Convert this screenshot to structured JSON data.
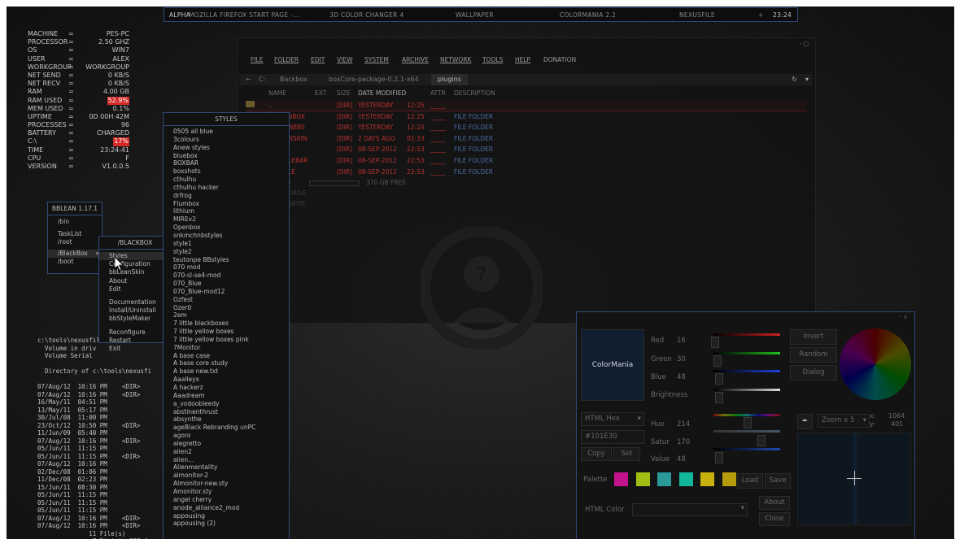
{
  "taskbar": {
    "items": [
      "ALPHA",
      "MOZILLA FIREFOX START PAGE -...",
      "3D COLOR CHANGER 4",
      "WALLPAPER",
      "COLORMANIA 2.2",
      "NEXUSFILE"
    ],
    "tray": "+",
    "clock": "23:24"
  },
  "stats": [
    {
      "k": "MACHINE",
      "v": "PES-PC"
    },
    {
      "k": "PROCESSOR",
      "v": "2.50 GHZ"
    },
    {
      "k": "OS",
      "v": "WIN7"
    },
    {
      "k": "USER",
      "v": "ALEX"
    },
    {
      "k": "WORKGROUP",
      "v": "WORKGROUP"
    },
    {
      "k": "NET SEND",
      "v": "0 KB/S"
    },
    {
      "k": "NET RECV",
      "v": "0 KB/S"
    },
    {
      "k": "RAM",
      "v": "4.00 GB"
    },
    {
      "k": "RAM USED",
      "v": "52.9%"
    },
    {
      "k": "MEM USED",
      "v": "0.1%"
    },
    {
      "k": "UPTIME",
      "v": "0D 00H 42M"
    },
    {
      "k": "PROCESSES",
      "v": "96"
    },
    {
      "k": "BATTERY",
      "v": "CHARGED"
    },
    {
      "k": "C:\\",
      "v": "17%"
    },
    {
      "k": "TIME",
      "v": "23:24:41"
    },
    {
      "k": "CPU",
      "v": "F"
    },
    {
      "k": "VERSION",
      "v": "V1.0.0.5"
    }
  ],
  "bblean": {
    "title": "BBLEAN 1.17.1",
    "items": [
      "/bin",
      "TaskList",
      "/root",
      "/BlackBox",
      "/boot"
    ]
  },
  "blackbox": {
    "title": "/BLACKBOX",
    "items": [
      "Styles",
      "Configuration",
      "bbLeanSkin",
      "About",
      "Edit",
      "Documentation",
      "Install/Uninstall",
      "bbStyleMaker",
      "Reconfigure",
      "Restart",
      "Exit"
    ]
  },
  "styles": {
    "title": "STYLES",
    "items": [
      "0505 all blue",
      "3colours",
      "Anew styles",
      "bluebox",
      "BOXBAR",
      "boxshots",
      "cthulhu",
      "cthulhu hacker",
      "drfrog",
      "Flumbox",
      "lithium",
      "MIREv2",
      "Openbox",
      "snkmchnbstyles",
      "style1",
      "style2",
      "teutonpe BBstyles",
      "070 mod",
      "070-sl-se4-mod",
      "070_Blue",
      "070_Blue-mod12",
      "Ozfest",
      "Ozer0",
      "2em",
      "7 little blackboxes",
      "7 little yellow boxes",
      "7 little yellow boxes pink",
      "7Monitor",
      "A base case",
      "A base core study",
      "A base new.txt",
      "Aaalleyx",
      "A hackerz",
      "Aaadream",
      "a_vodoobleedy",
      "abstinenthrust",
      "absynthe",
      "ageBlack Rebranding unPC",
      "agoro",
      "alegretto",
      "alien2",
      "alien...",
      "Alienmentality",
      "almonitor-2",
      "Almonitor-new.sty",
      "Amonitor.sty",
      "angel cherry",
      "anode_alliance2_mod",
      "appousing",
      "appousing (2)"
    ]
  },
  "explorer": {
    "menu": [
      "FILE",
      "FOLDER",
      "EDIT",
      "VIEW",
      "SYSTEM",
      "ARCHIVE",
      "NETWORK",
      "TOOLS",
      "HELP",
      "DONATION"
    ],
    "path": [
      "C:",
      "Backbox",
      "boxCore-package-0.2.1-x64",
      "plugins"
    ],
    "columns": [
      "NAME",
      "EXT",
      "SIZE",
      "DATE MODIFIED",
      "ATTR",
      "DESCRIPTION"
    ],
    "rows": [
      {
        "name": "..",
        "size": "[DIR]",
        "date": "YESTERDAY",
        "time": "12:25",
        "attr": "_____",
        "desc": ""
      },
      {
        "name": "BBICONBOX",
        "size": "[DIR]",
        "date": "YESTERDAY",
        "time": "12:25",
        "attr": "_____",
        "desc": "FILE FOLDER"
      },
      {
        "name": "BBLEANBBS",
        "size": "[DIR]",
        "date": "YESTERDAY",
        "time": "12:24",
        "attr": "_____",
        "desc": "FILE FOLDER"
      },
      {
        "name": "BBLEANSKIN",
        "size": "[DIR]",
        "date": "2 DAYS AGO",
        "time": "01:33",
        "attr": "_____",
        "desc": "FILE FOLDER"
      },
      {
        "name": "BBSLIT",
        "size": "[DIR]",
        "date": "08-SEP-2012",
        "time": "22:53",
        "attr": "_____",
        "desc": "FILE FOLDER"
      },
      {
        "name": "BBSTYLEBAR",
        "size": "[DIR]",
        "date": "08-SEP-2012",
        "time": "22:53",
        "attr": "_____",
        "desc": "FILE FOLDER"
      },
      {
        "name": "BBSTYLE",
        "size": "[DIR]",
        "date": "08-SEP-2012",
        "time": "22:53",
        "attr": "_____",
        "desc": "FILE FOLDER"
      }
    ],
    "drives": [
      {
        "label": "C: HDD",
        "free": "370 GB FREE"
      },
      {
        "label": "D: CD DRIVE",
        "free": ""
      },
      {
        "label": "E: CD DRIVE",
        "free": ""
      }
    ]
  },
  "console": {
    "lines": [
      "c:\\tools\\nexusfil",
      "  Volume in driv",
      "  Volume Serial",
      "",
      "  Directory of c:\\tools\\nexusfi",
      "",
      "07/Aug/12  10:16 PM    <DIR>",
      "07/Aug/12  10:16 PM    <DIR>",
      "16/May/11  04:51 PM",
      "13/May/11  05:17 PM",
      "30/Jul/08  11:00 PM",
      "23/Oct/12  10:50 PM    <DIR>",
      "11/Jun/09  05:40 PM",
      "07/Aug/12  10:16 PM    <DIR>",
      "05/Jun/11  11:15 PM",
      "05/Jun/11  11:15 PM    <DIR>",
      "07/Aug/12  10:16 PM",
      "02/Dec/08  01:06 PM",
      "11/Dec/08  02:23 PM",
      "15/Jun/11  08:30 PM",
      "05/Jun/11  11:15 PM",
      "05/Jun/11  11:15 PM",
      "05/Jun/11  11:15 PM",
      "07/Aug/12  10:16 PM    <DIR>",
      "07/Aug/12  10:16 PM    <DIR>",
      "              11 File(s)",
      "               7 Dir(s)  897,4",
      "",
      "c:\\tools\\nexusfile5.3.1\\NexusFile"
    ]
  },
  "colormania": {
    "preview_label": "ColorMania",
    "red_label": "Red",
    "red": "16",
    "green_label": "Green",
    "green": "30",
    "blue_label": "Blue",
    "blue": "48",
    "brightness_label": "Brightness",
    "hue_label": "Hue",
    "hue": "214",
    "satur_label": "Satur",
    "satur": "170",
    "value_label": "Value",
    "value": "48",
    "format": "HTML Hex",
    "hex": "#101E30",
    "copy": "Copy",
    "set": "Set",
    "invert": "Invert",
    "random": "Random",
    "dialog": "Dialog",
    "zoom": "Zoom x 5",
    "x_label": "x:",
    "x": "1064",
    "y_label": "y:",
    "y": "401",
    "palette_label": "Palette",
    "palette": [
      "#c3138d",
      "#a1bf13",
      "#2a9a9a",
      "#13b89a",
      "#c9b10d",
      "#b59c0a"
    ],
    "load": "Load",
    "save": "Save",
    "html_color_label": "HTML Color",
    "about": "About",
    "close": "Close",
    "preview_color": "#101e30"
  }
}
